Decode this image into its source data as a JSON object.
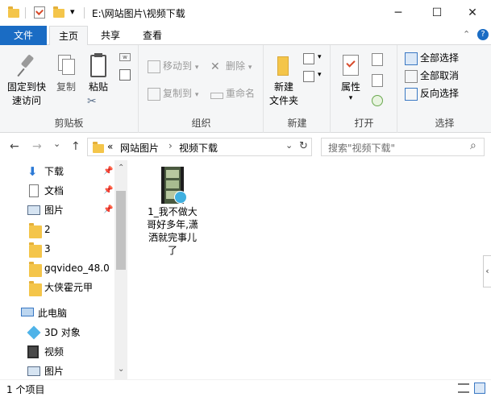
{
  "window": {
    "title": "E:\\网站图片\\视频下载",
    "minimize_glyph": "─",
    "maximize_glyph": "☐",
    "close_glyph": "✕",
    "qat_dropdown_glyph": "▾"
  },
  "tabs": {
    "file": "文件",
    "home": "主页",
    "share": "共享",
    "view": "查看",
    "collapse_glyph": "⌃",
    "help_glyph": "?"
  },
  "ribbon": {
    "clipboard": {
      "label": "剪贴板",
      "pin": "固定到快\n速访问",
      "copy": "复制",
      "paste": "粘贴"
    },
    "organize": {
      "label": "组织",
      "move_to": "移动到",
      "copy_to": "复制到",
      "delete": "删除",
      "rename": "重命名",
      "dropdown_glyph": "▾"
    },
    "new": {
      "label": "新建",
      "new_folder": "新建\n文件夹"
    },
    "open": {
      "label": "打开",
      "properties": "属性"
    },
    "select": {
      "label": "选择",
      "select_all": "全部选择",
      "select_none": "全部取消",
      "invert": "反向选择"
    }
  },
  "address": {
    "prefix": "«",
    "crumbs": [
      "网站图片",
      "视频下载"
    ],
    "separator": "›",
    "back_glyph": "←",
    "forward_glyph": "→",
    "history_glyph": "⌄",
    "up_glyph": "↑",
    "dropdown_glyph": "⌄",
    "refresh_glyph": "↻",
    "search_placeholder": "搜索\"视频下载\"",
    "search_glyph": "⌕"
  },
  "nav": {
    "items": [
      {
        "label": "下载",
        "pinned": true
      },
      {
        "label": "文档",
        "pinned": true
      },
      {
        "label": "图片",
        "pinned": true
      },
      {
        "label": "2"
      },
      {
        "label": "3"
      },
      {
        "label": "gqvideo_48.0"
      },
      {
        "label": "大侠霍元甲"
      },
      {
        "label": "此电脑"
      },
      {
        "label": "3D 对象"
      },
      {
        "label": "视频"
      },
      {
        "label": "图片"
      }
    ],
    "pin_glyph": "📌",
    "scroll_up_glyph": "⌃",
    "scroll_down_glyph": "⌄"
  },
  "content": {
    "files": [
      {
        "name": "1_我不做大哥好多年,潇洒就完事儿了"
      }
    ]
  },
  "status": {
    "count": "1 个项目"
  },
  "colors": {
    "accent": "#1a6cc4",
    "folder": "#f4c54a"
  }
}
